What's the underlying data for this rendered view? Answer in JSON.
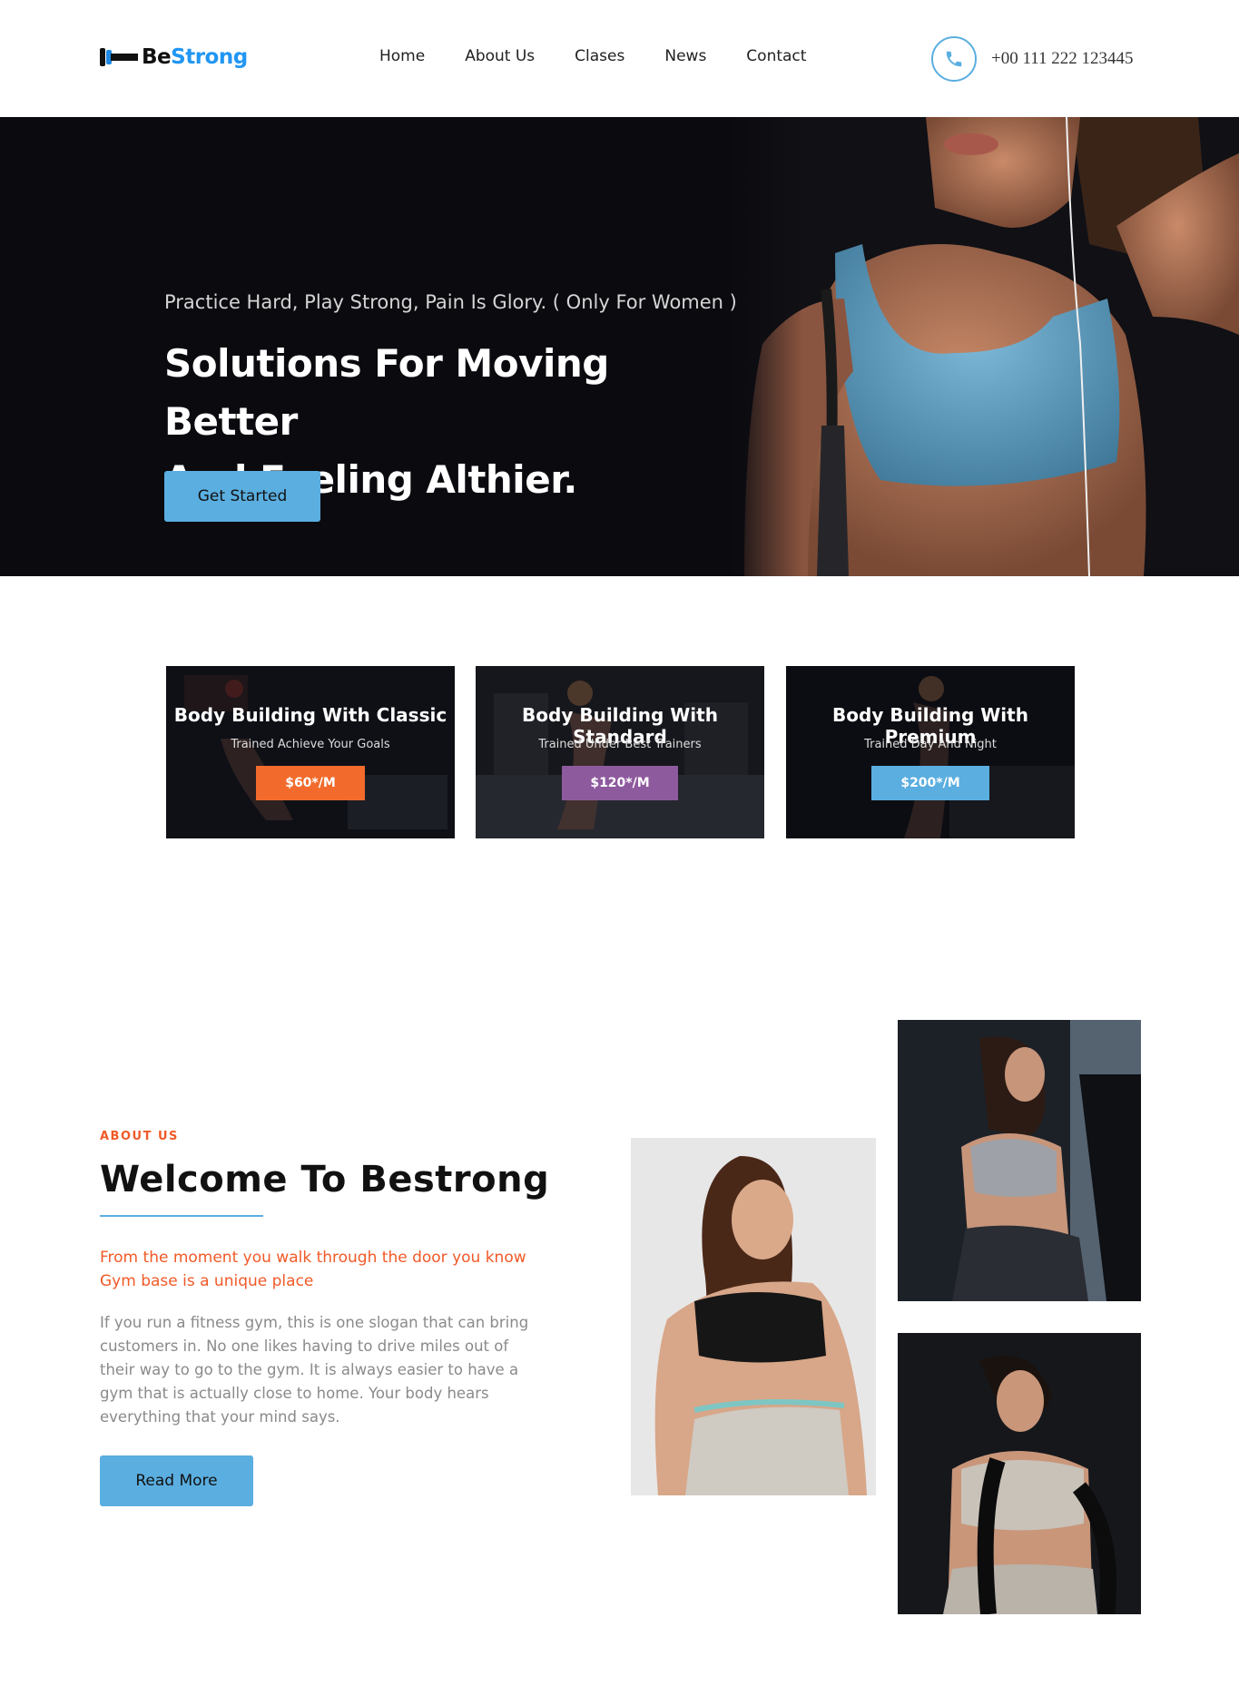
{
  "header": {
    "logo_be": "Be",
    "logo_strong": "Strong",
    "nav": [
      "Home",
      "About Us",
      "Clases",
      "News",
      "Contact"
    ],
    "phone": "+00 111 222 123445"
  },
  "hero": {
    "subtitle": "Practice Hard, Play Strong, Pain Is Glory. ( Only For Women )",
    "title_line1": "Solutions For Moving Better",
    "title_line2": "And Feeling Althier.",
    "cta": "Get Started"
  },
  "plans": [
    {
      "title": "Body Building With Classic",
      "subtitle": "Trained Achieve Your Goals",
      "price": "$60*/M",
      "color": "#f26b2c"
    },
    {
      "title": "Body Building With Standard",
      "subtitle": "Trained Under Best Trainers",
      "price": "$120*/M",
      "color": "#8e5a9e"
    },
    {
      "title": "Body Building With Premium",
      "subtitle": "Trained Day And Night",
      "price": "$200*/M",
      "color": "#5aaee0"
    }
  ],
  "about": {
    "label": "ABOUT US",
    "title": "Welcome To Bestrong",
    "lead": "From the moment you walk through the door you know Gym base is a unique place",
    "body": "If you run a fitness gym, this is one slogan that can bring customers in. No one likes having to drive miles out of their way to go to the gym. It is always easier to have a gym that is actually close to home. Your body hears everything that your mind says.",
    "cta": "Read More"
  },
  "colors": {
    "accent_blue": "#5aaee0",
    "accent_orange": "#f05a28",
    "hero_bg": "#0a0a0f"
  },
  "icons": {
    "logo": "dumbbell-icon",
    "phone": "phone-icon"
  }
}
